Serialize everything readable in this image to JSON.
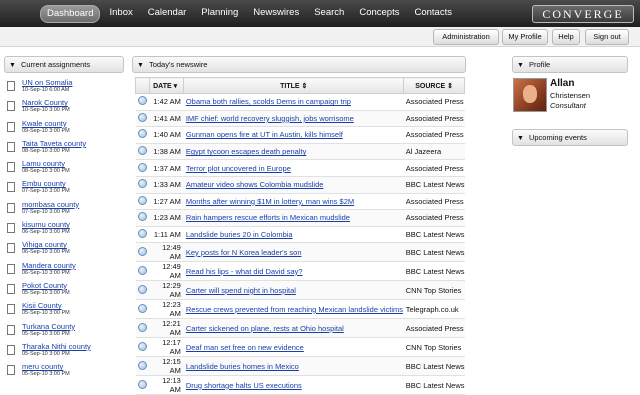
{
  "nav": {
    "items": [
      "Dashboard",
      "Inbox",
      "Calendar",
      "Planning",
      "Newswires",
      "Search",
      "Concepts",
      "Contacts"
    ],
    "active": "Dashboard",
    "logo": "CONVERGE"
  },
  "subnav": {
    "administration": "Administration",
    "my_profile": "My Profile",
    "help": "Help",
    "sign_out": "Sign out"
  },
  "assignments": {
    "header": "Current assignments",
    "items": [
      {
        "title": "UN on Somalia",
        "date": "10-Sep-10 6:00 AM"
      },
      {
        "title": "Narok County",
        "date": "10-Sep-10 3:00 PM"
      },
      {
        "title": "Kwale county",
        "date": "09-Sep-10 3:00 PM"
      },
      {
        "title": "Taita Taveta county",
        "date": "08-Sep-10 3:00 PM"
      },
      {
        "title": "Lamu county",
        "date": "08-Sep-10 3:00 PM"
      },
      {
        "title": "Embu county",
        "date": "07-Sep-10 3:00 PM"
      },
      {
        "title": "mombasa county",
        "date": "07-Sep-10 3:00 PM"
      },
      {
        "title": "kisumu county",
        "date": "06-Sep-10 3:00 PM"
      },
      {
        "title": "Vihiga county",
        "date": "06-Sep-10 3:00 PM"
      },
      {
        "title": "Mandera county",
        "date": "06-Sep-10 3:00 PM"
      },
      {
        "title": "Pokot County",
        "date": "05-Sep-10 3:00 PM"
      },
      {
        "title": "Kisii County",
        "date": "05-Sep-10 3:00 PM"
      },
      {
        "title": "Turkana County",
        "date": "05-Sep-10 3:00 PM"
      },
      {
        "title": "Tharaka Nithi county",
        "date": "05-Sep-10 3:00 PM"
      },
      {
        "title": "meru county",
        "date": "05-Sep-10 3:00 PM"
      }
    ]
  },
  "newswire": {
    "header": "Today's newswire",
    "columns": {
      "date": "DATE ▾",
      "title": "TITLE ⇕",
      "source": "SOURCE ⇕"
    },
    "rows": [
      {
        "time": "1:42 AM",
        "title": "Obama both rallies, scolds Dems in campaign trip",
        "source": "Associated Press"
      },
      {
        "time": "1:41 AM",
        "title": "IMF chief: world recovery sluggish, jobs worrisome",
        "source": "Associated Press"
      },
      {
        "time": "1:40 AM",
        "title": "Gunman opens fire at UT in Austin, kills himself",
        "source": "Associated Press"
      },
      {
        "time": "1:38 AM",
        "title": "Egypt tycoon escapes death penalty",
        "source": "Al Jazeera"
      },
      {
        "time": "1:37 AM",
        "title": "Terror plot uncovered in Europe",
        "source": "Associated Press"
      },
      {
        "time": "1:33 AM",
        "title": "Amateur video shows Colombia mudslide",
        "source": "BBC Latest News"
      },
      {
        "time": "1:27 AM",
        "title": "Months after winning $1M in lottery, man wins $2M",
        "source": "Associated Press"
      },
      {
        "time": "1:23 AM",
        "title": "Rain hampers rescue efforts in Mexican mudslide",
        "source": "Associated Press"
      },
      {
        "time": "1:11 AM",
        "title": "Landslide buries 20 in Colombia",
        "source": "BBC Latest News"
      },
      {
        "time": "12:49 AM",
        "title": "Key posts for N Korea leader's son",
        "source": "BBC Latest News"
      },
      {
        "time": "12:49 AM",
        "title": "Read his lips - what did David say?",
        "source": "BBC Latest News"
      },
      {
        "time": "12:29 AM",
        "title": "Carter will spend night in hospital",
        "source": "CNN Top Stories"
      },
      {
        "time": "12:23 AM",
        "title": "Rescue crews prevented from reaching Mexican landslide victims",
        "source": "Telegraph.co.uk"
      },
      {
        "time": "12:21 AM",
        "title": "Carter sickened on plane, rests at Ohio hospital",
        "source": "Associated Press"
      },
      {
        "time": "12:17 AM",
        "title": "Deaf man set free on new evidence",
        "source": "CNN Top Stories"
      },
      {
        "time": "12:15 AM",
        "title": "Landslide buries homes in Mexico",
        "source": "BBC Latest News"
      },
      {
        "time": "12:13 AM",
        "title": "Drug shortage halts US executions",
        "source": "BBC Latest News"
      }
    ]
  },
  "profile": {
    "header": "Profile",
    "first_name": "Allan",
    "last_name": "Christensen",
    "role": "Consultant"
  },
  "events": {
    "header": "Upcoming events"
  }
}
